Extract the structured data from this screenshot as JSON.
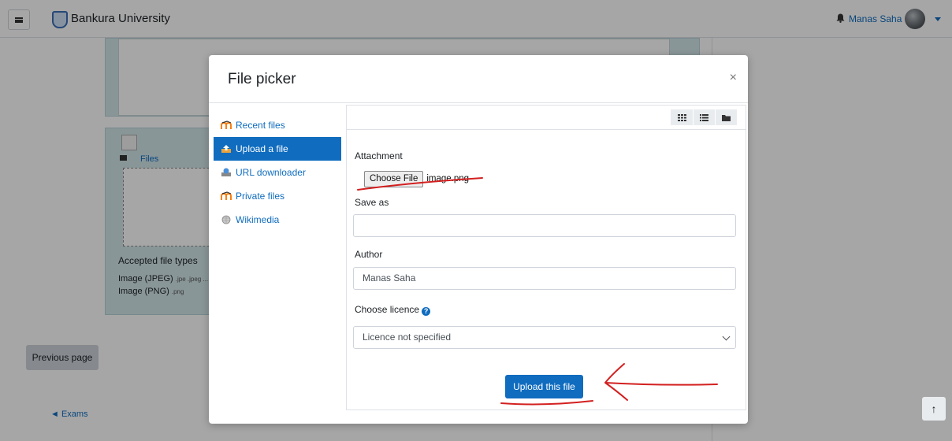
{
  "navbar": {
    "site_title": "Bankura University",
    "user_name": "Manas Saha",
    "icons": [
      "hamburger-menu-icon",
      "university-logo",
      "bell-icon",
      "avatar",
      "caret-down-icon"
    ]
  },
  "page": {
    "files_label": "Files",
    "accepted_types_title": "Accepted file types",
    "type_jpeg": "Image (JPEG)",
    "type_jpeg_ext": ".jpe .jpeg ...",
    "type_png": "Image (PNG)",
    "type_png_ext": ".png",
    "previous_page": "Previous page",
    "exams_link": "◄ Exams",
    "back_to_top": "↑"
  },
  "file_picker": {
    "title": "File picker",
    "close": "×",
    "repositories": [
      {
        "label": "Recent files",
        "icon": "moodle-icon",
        "active": false
      },
      {
        "label": "Upload a file",
        "icon": "upload-icon",
        "active": true
      },
      {
        "label": "URL downloader",
        "icon": "url-downloader-icon",
        "active": false
      },
      {
        "label": "Private files",
        "icon": "moodle-icon",
        "active": false
      },
      {
        "label": "Wikimedia",
        "icon": "wikimedia-icon",
        "active": false
      }
    ],
    "view_buttons": [
      "grid-view-icon",
      "list-view-icon",
      "folder-view-icon"
    ],
    "form": {
      "attachment_label": "Attachment",
      "choose_file_button": "Choose File",
      "chosen_file_name": "image.png",
      "save_as_label": "Save as",
      "save_as_value": "",
      "author_label": "Author",
      "author_value": "Manas Saha",
      "licence_label": "Choose licence",
      "licence_value": "Licence not specified",
      "upload_button": "Upload this file"
    }
  },
  "colors": {
    "primary": "#0f6cbf",
    "annotation_red": "#d32020",
    "teal_panel": "#d3e6ea"
  }
}
